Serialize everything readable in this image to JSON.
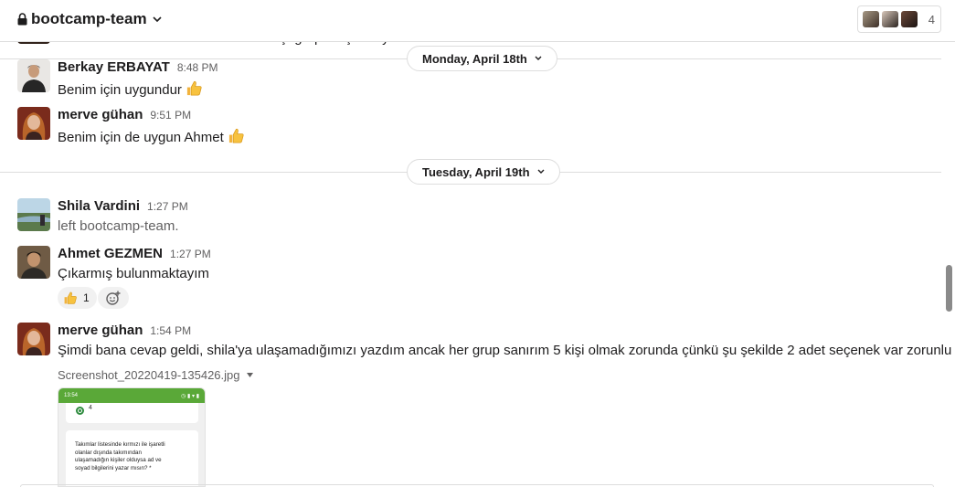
{
  "header": {
    "channel_name": "bootcamp-team",
    "member_count": "4"
  },
  "partial_message": {
    "text": "O zaman herkesin izni olursa arkadaşı gruptan çıkartıyorum."
  },
  "dates": [
    {
      "label": "Monday, April 18th"
    },
    {
      "label": "Tuesday, April 19th"
    }
  ],
  "messages": [
    {
      "sender": "Berkay ERBAYAT",
      "time": "8:48 PM",
      "text": "Benim için uygundur",
      "emoji": "thumbs-up"
    },
    {
      "sender": "merve gühan",
      "time": "9:51 PM",
      "text": "Benim için de uygun Ahmet",
      "emoji": "thumbs-up"
    },
    {
      "sender": "Shila Vardini",
      "time": "1:27 PM",
      "text": "left bootcamp-team."
    },
    {
      "sender": "Ahmet GEZMEN",
      "time": "1:27 PM",
      "text": "Çıkarmış bulunmaktayım",
      "reaction": {
        "emoji": "thumbs-up",
        "count": "1"
      }
    },
    {
      "sender": "merve gühan",
      "time": "1:54 PM",
      "text": "Şimdi bana cevap geldi, shila'ya ulaşamadığımızı yazdım ancak her grup sanırım 5 kişi olmak zorunda çünkü şu şekilde 2 adet seçenek var zorunlu",
      "attachment": {
        "filename": "Screenshot_20220419-135426.jpg",
        "preview_time": "13:54",
        "preview_option": "4",
        "preview_text": "Takımlar listesinde kırmızı ile işaretli\nolanlar dışında takımından\nulaşamadığın kişiler olduysa ad ve\nsoyad bilgilerini yazar mısın? *"
      }
    }
  ],
  "colors": {
    "divider": "#dddddd",
    "secondary_text": "#616061",
    "primary_text": "#1d1c1d",
    "preview_header": "#5aa838"
  }
}
